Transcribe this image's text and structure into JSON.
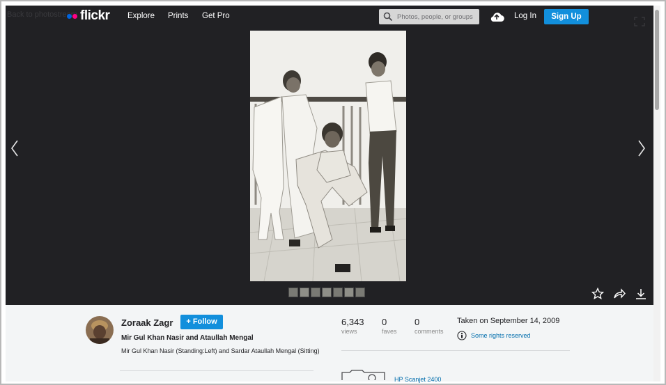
{
  "header": {
    "back_text": "Back to photostream",
    "logo_text": "flickr",
    "nav": [
      "Explore",
      "Prints",
      "Get Pro"
    ],
    "search_placeholder": "Photos, people, or groups",
    "login_label": "Log In",
    "signup_label": "Sign Up"
  },
  "colors": {
    "brand_blue": "#0063dc",
    "brand_pink": "#ff0084",
    "button_blue": "#128fdc",
    "link_blue": "#006dac"
  },
  "icons": {
    "search": "search-icon",
    "upload": "cloud-upload-icon",
    "expand": "expand-icon",
    "prev": "chevron-left-icon",
    "next": "chevron-right-icon",
    "fave": "star-icon",
    "share": "share-icon",
    "download": "download-icon",
    "license": "creative-commons-icon",
    "camera": "camera-icon"
  },
  "photo": {
    "thumb_count": 7
  },
  "owner": {
    "name": "Zoraak Zagr",
    "follow_label": "+ Follow",
    "photo_title": "Mir Gul Khan Nasir and Ataullah Mengal",
    "photo_description": "Mir Gul Khan Nasir (Standing:Left) and Sardar Ataullah Mengal (Sitting)"
  },
  "stats": {
    "views": {
      "value": "6,343",
      "label": "views"
    },
    "faves": {
      "value": "0",
      "label": "faves"
    },
    "comments": {
      "value": "0",
      "label": "comments"
    }
  },
  "meta": {
    "taken": "Taken on September 14, 2009",
    "license": "Some rights reserved",
    "camera_label": "HP Scanjet 2400"
  }
}
